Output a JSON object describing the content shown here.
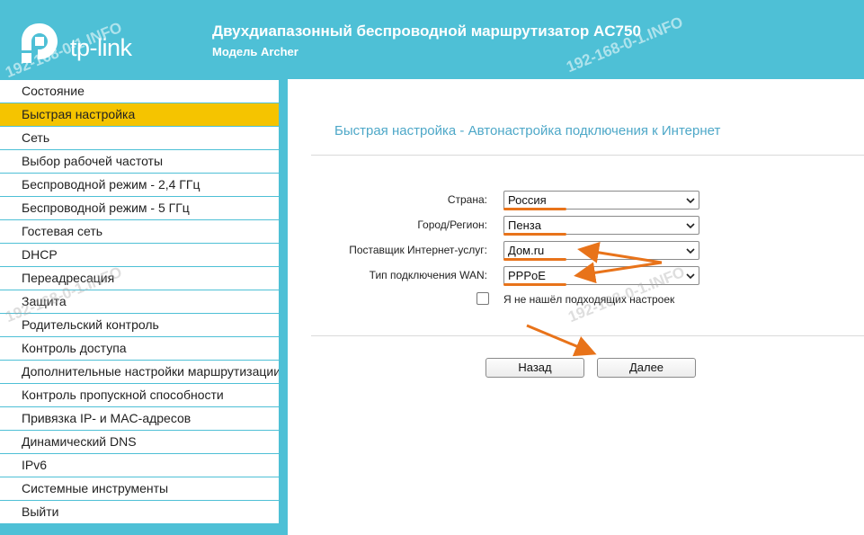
{
  "header": {
    "logo_text": "tp-link",
    "title": "Двухдиапазонный беспроводной маршрутизатор AC750",
    "model": "Модель Archer"
  },
  "sidebar": {
    "items": [
      {
        "label": "Состояние",
        "active": false
      },
      {
        "label": "Быстрая настройка",
        "active": true
      },
      {
        "label": "Сеть",
        "active": false
      },
      {
        "label": "Выбор рабочей частоты",
        "active": false
      },
      {
        "label": "Беспроводной режим - 2,4 ГГц",
        "active": false
      },
      {
        "label": "Беспроводной режим - 5 ГГц",
        "active": false
      },
      {
        "label": "Гостевая сеть",
        "active": false
      },
      {
        "label": "DHCP",
        "active": false
      },
      {
        "label": "Переадресация",
        "active": false
      },
      {
        "label": "Защита",
        "active": false
      },
      {
        "label": "Родительский контроль",
        "active": false
      },
      {
        "label": "Контроль доступа",
        "active": false
      },
      {
        "label": "Дополнительные настройки маршрутизации",
        "active": false
      },
      {
        "label": "Контроль пропускной способности",
        "active": false
      },
      {
        "label": "Привязка IP- и MAC-адресов",
        "active": false
      },
      {
        "label": "Динамический DNS",
        "active": false
      },
      {
        "label": "IPv6",
        "active": false
      },
      {
        "label": "Системные инструменты",
        "active": false
      },
      {
        "label": "Выйти",
        "active": false
      }
    ]
  },
  "main": {
    "title": "Быстрая настройка - Автонастройка подключения к Интернет",
    "fields": {
      "country": {
        "label": "Страна:",
        "value": "Россия"
      },
      "city": {
        "label": "Город/Регион:",
        "value": "Пенза"
      },
      "isp": {
        "label": "Поставщик Интернет-услуг:",
        "value": "Дом.ru"
      },
      "wan": {
        "label": "Тип подключения WAN:",
        "value": "PPPoE"
      }
    },
    "checkbox_label": "Я не нашёл подходящих настроек",
    "back_button": "Назад",
    "next_button": "Далее"
  },
  "watermark": "192-168-0-1.INFO",
  "colors": {
    "header": "#4ec0d6",
    "active_menu": "#f5c400",
    "annotation": "#e8731a",
    "title_text": "#4ea8c8"
  }
}
